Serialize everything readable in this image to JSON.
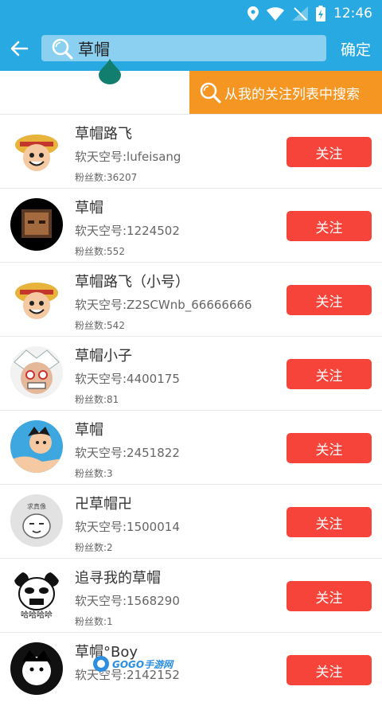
{
  "status_bar": {
    "time": "12:46"
  },
  "header": {
    "search_value": "草帽",
    "confirm_label": "确定"
  },
  "filter_button": {
    "label": "从我的关注列表中搜索"
  },
  "results": [
    {
      "name": "草帽路飞",
      "uid": "软天空号:lufeisang",
      "fans": "粉丝数:36207",
      "follow": "关注"
    },
    {
      "name": "草帽",
      "uid": "软天空号:1224502",
      "fans": "粉丝数:552",
      "follow": "关注"
    },
    {
      "name": "草帽路飞（小号）",
      "uid": "软天空号:Z2SCWnb_66666666",
      "fans": "粉丝数:542",
      "follow": "关注"
    },
    {
      "name": "草帽小子",
      "uid": "软天空号:4400175",
      "fans": "粉丝数:81",
      "follow": "关注"
    },
    {
      "name": "草帽",
      "uid": "软天空号:2451822",
      "fans": "粉丝数:3",
      "follow": "关注"
    },
    {
      "name": "卍草帽卍",
      "uid": "软天空号:1500014",
      "fans": "粉丝数:2",
      "follow": "关注"
    },
    {
      "name": "追寻我的草帽",
      "uid": "软天空号:1568290",
      "fans": "粉丝数:1",
      "follow": "关注"
    },
    {
      "name": "草帽°Boy",
      "uid": "软天空号:2142152",
      "fans": "",
      "follow": "关注"
    }
  ],
  "avatar_images": {
    "r6_sticker": "求真像",
    "r7_meme": "哈哈哈哈"
  },
  "watermark": {
    "text": "GOGO手游网"
  },
  "colors": {
    "header_blue": "#29a9e1",
    "search_fill": "#8bd0f1",
    "filter_orange": "#f59522",
    "follow_red": "#f7443a"
  }
}
